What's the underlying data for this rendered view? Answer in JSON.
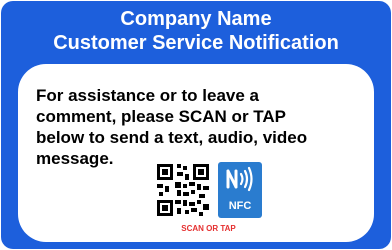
{
  "card": {
    "title_line1": "Company Name",
    "title_line2": "Customer Service Notification",
    "message_line1": "For assistance or to leave a",
    "message_line2": "comment,  please SCAN or TAP",
    "message_line3": "below to send a text, audio, video",
    "message_line4": "message.",
    "nfc_label": "NFC",
    "scan_label": "SCAN OR TAP"
  },
  "colors": {
    "brand_blue": "#1d5fdc",
    "nfc_blue": "#2a7ccf",
    "scan_red": "#e53030"
  },
  "icons": {
    "qr": "qr-code-icon",
    "nfc": "nfc-icon"
  }
}
